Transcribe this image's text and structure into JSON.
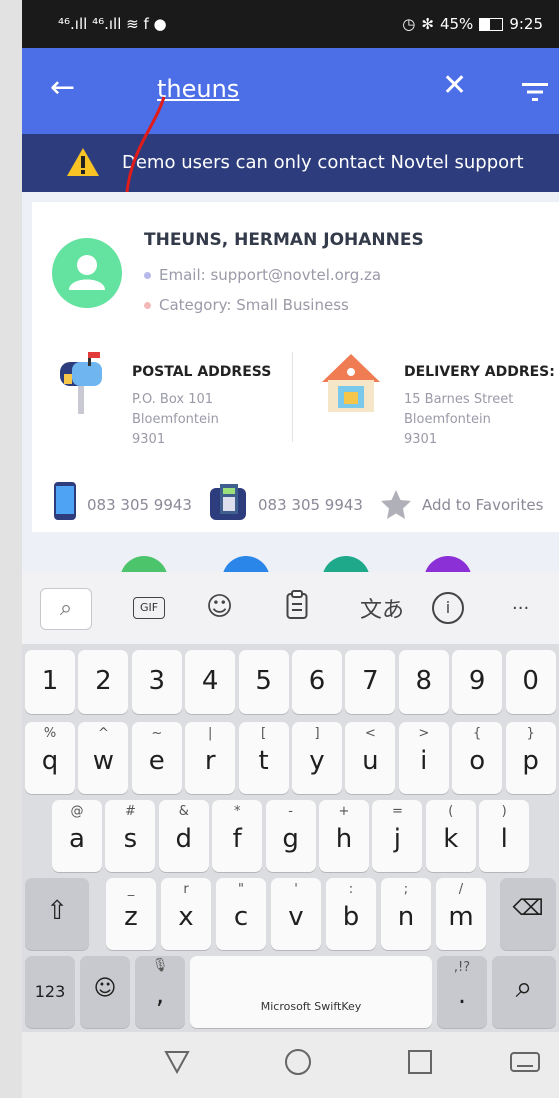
{
  "status_bar": {
    "left": "⁴⁶.ıll ⁴⁶.ıll ≋ f ●",
    "alarm": "◷",
    "bluetooth": "✻",
    "battery": "45%",
    "time": "9:25"
  },
  "app_bar": {
    "search_query": "theuns"
  },
  "banner": {
    "text": "Demo users can only contact Novtel support"
  },
  "contact": {
    "name": "THEUNS, HERMAN JOHANNES",
    "email": "Email: support@novtel.org.za",
    "category": "Category: Small Business",
    "postal": {
      "title": "POSTAL ADDRESS",
      "line1": "P.O. Box 101",
      "line2": "Bloemfontein",
      "line3": "9301"
    },
    "delivery": {
      "title": "DELIVERY ADDRES:",
      "line1": "15 Barnes Street",
      "line2": "Bloemfontein",
      "line3": "9301"
    },
    "mobile": "083 305 9943",
    "landline": "083 305 9943",
    "favorite": "Add to Favorites"
  },
  "keyboard": {
    "toolbar": {
      "more": "···",
      "gif": "GIF"
    },
    "numbers": [
      "1",
      "2",
      "3",
      "4",
      "5",
      "6",
      "7",
      "8",
      "9",
      "0"
    ],
    "row1": [
      {
        "k": "q",
        "s": "%"
      },
      {
        "k": "w",
        "s": "^"
      },
      {
        "k": "e",
        "s": "~"
      },
      {
        "k": "r",
        "s": "|"
      },
      {
        "k": "t",
        "s": "["
      },
      {
        "k": "y",
        "s": "]"
      },
      {
        "k": "u",
        "s": "<"
      },
      {
        "k": "i",
        "s": ">"
      },
      {
        "k": "o",
        "s": "{"
      },
      {
        "k": "p",
        "s": "}"
      }
    ],
    "row2": [
      {
        "k": "a",
        "s": "@"
      },
      {
        "k": "s",
        "s": "#"
      },
      {
        "k": "d",
        "s": "&"
      },
      {
        "k": "f",
        "s": "*"
      },
      {
        "k": "g",
        "s": "-"
      },
      {
        "k": "h",
        "s": "+"
      },
      {
        "k": "j",
        "s": "="
      },
      {
        "k": "k",
        "s": "("
      },
      {
        "k": "l",
        "s": ")"
      }
    ],
    "row3": [
      {
        "k": "z",
        "s": "_"
      },
      {
        "k": "x",
        "s": "r"
      },
      {
        "k": "c",
        "s": "\""
      },
      {
        "k": "v",
        "s": "'"
      },
      {
        "k": "b",
        "s": ":"
      },
      {
        "k": "n",
        "s": ";"
      },
      {
        "k": "m",
        "s": "/"
      }
    ],
    "num_toggle": "123",
    "comma": ",",
    "period": ".",
    "period_sub": ",!?",
    "space": "Microsoft SwiftKey"
  }
}
